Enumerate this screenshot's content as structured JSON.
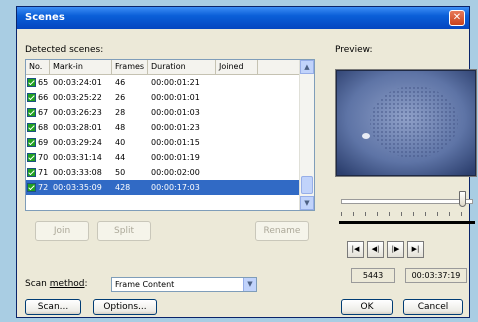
{
  "window": {
    "title": "Scenes",
    "close_label": "✕"
  },
  "detected": {
    "label": "Detected scenes:",
    "columns": [
      "No.",
      "Mark-in",
      "Frames",
      "Duration",
      "Joined"
    ],
    "rows": [
      {
        "no": "65",
        "mark_in": "00:03:24:01",
        "frames": "46",
        "duration": "00:00:01:21",
        "selected": false
      },
      {
        "no": "66",
        "mark_in": "00:03:25:22",
        "frames": "26",
        "duration": "00:00:01:01",
        "selected": false
      },
      {
        "no": "67",
        "mark_in": "00:03:26:23",
        "frames": "28",
        "duration": "00:00:01:03",
        "selected": false
      },
      {
        "no": "68",
        "mark_in": "00:03:28:01",
        "frames": "48",
        "duration": "00:00:01:23",
        "selected": false
      },
      {
        "no": "69",
        "mark_in": "00:03:29:24",
        "frames": "40",
        "duration": "00:00:01:15",
        "selected": false
      },
      {
        "no": "70",
        "mark_in": "00:03:31:14",
        "frames": "44",
        "duration": "00:00:01:19",
        "selected": false
      },
      {
        "no": "71",
        "mark_in": "00:03:33:08",
        "frames": "50",
        "duration": "00:00:02:00",
        "selected": false
      },
      {
        "no": "72",
        "mark_in": "00:03:35:09",
        "frames": "428",
        "duration": "00:00:17:03",
        "selected": true
      }
    ]
  },
  "list_buttons": {
    "join": "Join",
    "split": "Split",
    "rename": "Rename"
  },
  "scan_method": {
    "label_prefix": "Scan ",
    "label_u": "method",
    "label_suffix": ":",
    "value": "Frame Content"
  },
  "bottom_buttons": {
    "scan": "Scan...",
    "options": "Options...",
    "ok": "OK",
    "cancel": "Cancel"
  },
  "preview": {
    "label": "Preview:",
    "frame_field": "5443",
    "timecode_field": "00:03:37:19",
    "slider_position": 0.94,
    "nav": [
      "|◀",
      "◀|",
      "|▶",
      "▶|"
    ]
  },
  "colors": {
    "title_bar": "#0a5fd8",
    "selection": "#316ac5",
    "check": "#21a121",
    "desktop": "#a9cde3"
  }
}
